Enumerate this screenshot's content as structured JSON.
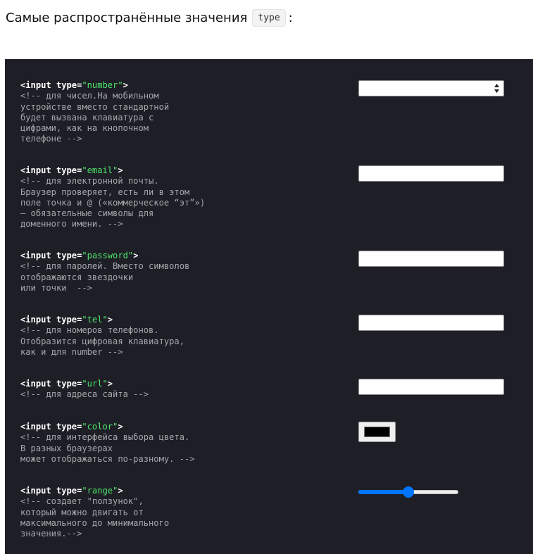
{
  "heading": {
    "text": "Самые распространённые значения",
    "code": "type",
    "suffix": ":"
  },
  "examples": [
    {
      "open": "<input type=",
      "value": "\"number\"",
      "close": ">",
      "comment": "<!-- для чисел.На мобильном\nустройстве вместо стандартной\nбудет вызвана клавиатура с\nцифрами, как на кнопочном\nтелефоне -->",
      "control": "number-input",
      "control_value": ""
    },
    {
      "open": "<input type=",
      "value": "\"email\"",
      "close": ">",
      "comment": "<!-- для электронной почты.\nБраузер проверяет, есть ли в этом\nполе точка и @ («коммерческое “эт”»)\n– обязательные символы для\nдоменного имени. -->",
      "control": "email-input",
      "control_value": ""
    },
    {
      "open": "<input type=",
      "value": "\"password\"",
      "close": ">",
      "comment": "<!-- для паролей. Вместо символов\nотображаются звездочки\nили точки  -->",
      "control": "password-input",
      "control_value": ""
    },
    {
      "open": "<input type=",
      "value": "\"tel\"",
      "close": ">",
      "comment": "<!-- для номеров телефонов.\nОтобразится цифровая клавиатура,\nкак и для number -->",
      "control": "tel-input",
      "control_value": ""
    },
    {
      "open": "<input type=",
      "value": "\"url\"",
      "close": ">",
      "comment": "<!-- для адреса сайта -->",
      "control": "url-input",
      "control_value": ""
    },
    {
      "open": "<input type=",
      "value": "\"color\"",
      "close": ">",
      "comment": "<!-- для интерфейса выбора цвета.\nВ разных браузерах\nможет отображаться по-разному. -->",
      "control": "color-picker",
      "control_value": "#000000"
    },
    {
      "open": "<input type=",
      "value": "\"range\"",
      "close": ">",
      "comment": "<!-- создает \"ползунок\",\nкоторый можно двигать от\nмаксимального до минимального\nзначения.-->",
      "control": "range-slider",
      "control_value": 0.5
    }
  ],
  "colors": {
    "panel_bg": "#1e1f26",
    "attr_value": "#4ee36b",
    "comment": "#a5a7ad",
    "slider_accent": "#0075ff"
  }
}
